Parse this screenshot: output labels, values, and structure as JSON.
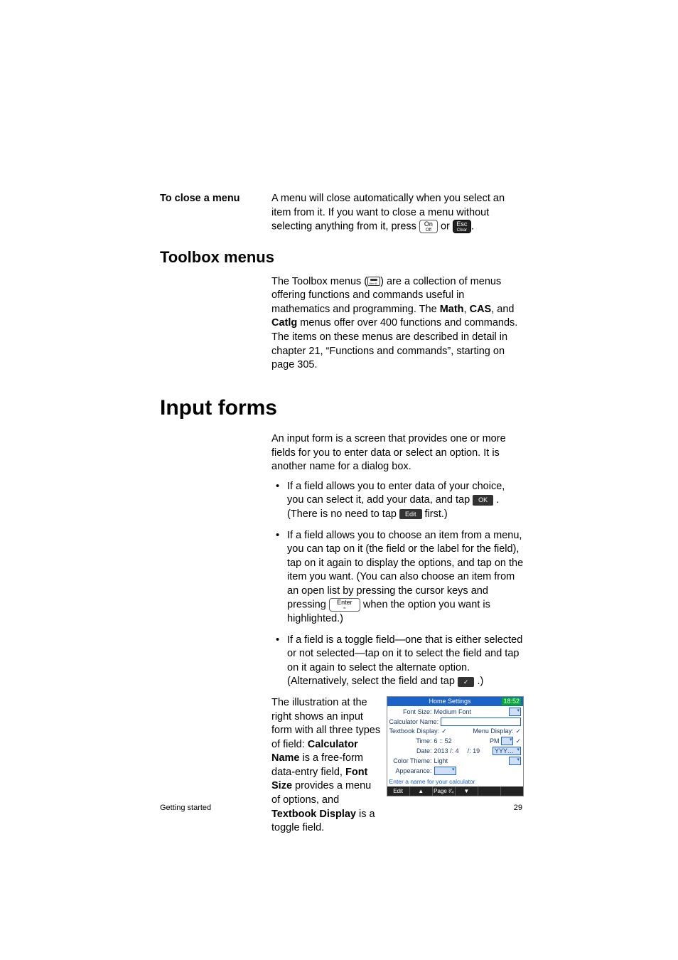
{
  "section1": {
    "side_heading": "To close a menu",
    "para": "A menu will close automatically when you select an item from it. If you want to close a menu without selecting anything from it, press ",
    "key_on_top": "On",
    "key_on_sub": "Off",
    "or_text": " or ",
    "key_esc_top": "Esc",
    "key_esc_sub": "Clear",
    "period": "."
  },
  "section2": {
    "heading": "Toolbox menus",
    "para_a": "The Toolbox menus (",
    "para_b": ") are a collection of menus offering functions and commands useful in mathematics and programming. The ",
    "b1": "Math",
    "c1": ", ",
    "b2": "CAS",
    "c2": ", and ",
    "b3": "Catlg",
    "para_c": " menus offer over 400 functions and commands. The items on these menus are described in detail in chapter 21, “Functions and commands”, starting on page 305."
  },
  "section3": {
    "heading": "Input forms",
    "intro": "An input form is a screen that provides one or more fields for you to enter data or select an option. It is another name for a dialog box.",
    "bullets": [
      {
        "a": "If a field allows you to enter data of your choice, you can select it, add your data, and tap ",
        "sk1": "OK",
        "b": ". (There is no need to tap ",
        "sk2": "Edit",
        "c": " first.)"
      },
      {
        "a": "If a field allows you to choose an item from a menu, you can tap on it (the field or the label for the field), tap on it again to display the options, and tap on the item you want. (You can also choose an item from an open list by pressing the cursor keys and pressing ",
        "key_top": "Enter",
        "key_sub": "≈",
        "b": " when the option you want is highlighted.)"
      },
      {
        "a": "If a field is a toggle field—one that is either selected or not selected—tap on it to select the field and tap on it again to select the alternate option. (Alternatively, select the field and tap ",
        "sk1": "✓",
        "b": ".)"
      }
    ],
    "illus_text_a": "The illustration at the right shows an input form with all three types of field: ",
    "b1": "Calculator Name",
    "t1": " is a free-form data-entry field, ",
    "b2": "Font Size",
    "t2": " provides a menu of options, and ",
    "b3": "Textbook Display",
    "t3": " is a toggle field."
  },
  "calc": {
    "title": "Home Settings",
    "time": "18:52",
    "rows": {
      "font_size_l": "Font Size:",
      "font_size_v": "Medium Font",
      "calc_name_l": "Calculator Name:",
      "textbook_l": "Textbook Display:",
      "menu_disp_l": "Menu Display:",
      "time_l": "Time:",
      "time_h": "6",
      "time_sep": ":: 52",
      "pm": "PM",
      "date_l": "Date:",
      "date_y": "2013",
      "date_sep1": "/: 4",
      "date_sep2": "/: 19",
      "yyy": "YYY…",
      "color_l": "Color Theme:",
      "color_v": "Light",
      "appear_l": "Appearance:"
    },
    "hint": "Enter a name for your calculator",
    "menu": {
      "m1": "Edit",
      "m2": "▲",
      "m3": "Page ²⁄₄",
      "m4": "▼",
      "m5": "",
      "m6": ""
    }
  },
  "footer": {
    "left": "Getting started",
    "right": "29"
  }
}
